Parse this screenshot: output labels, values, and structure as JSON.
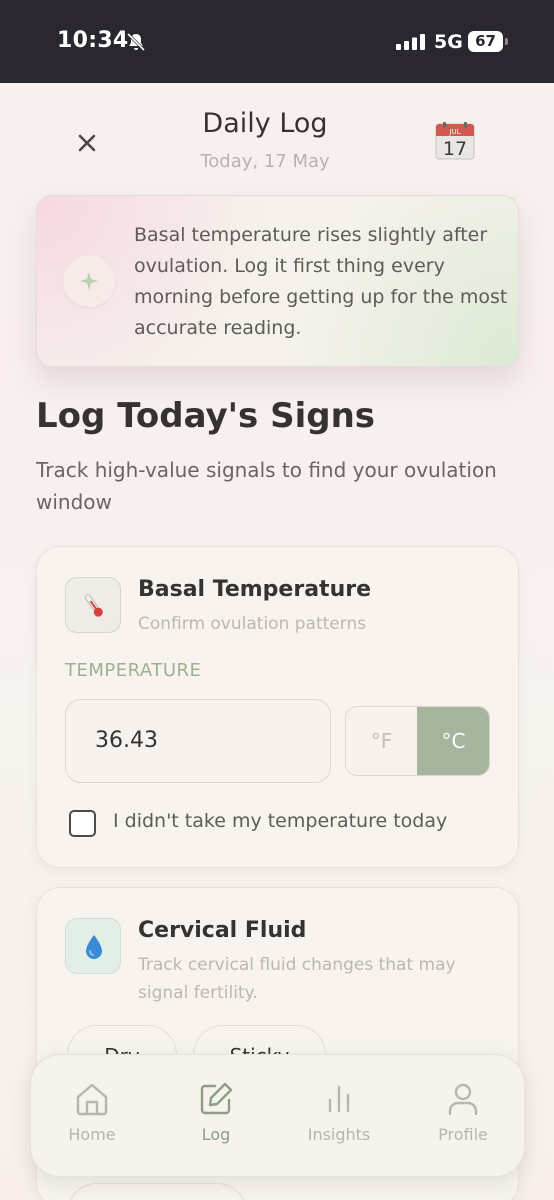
{
  "status_bar": {
    "time": "10:34",
    "network": "5G",
    "battery": "67",
    "icons": [
      "bell-slash-icon",
      "signal-icon",
      "battery-icon"
    ]
  },
  "header": {
    "title": "Daily Log",
    "subtitle": "Today, 17 May",
    "calendar_month": "JUL",
    "calendar_day": "17"
  },
  "tip": {
    "text": "Basal temperature rises slightly after ovulation. Log it first thing every morning before getting up for the most accurate reading."
  },
  "section": {
    "title": "Log Today's Signs",
    "subtitle": "Track high-value signals to find your ovulation window"
  },
  "temperature_card": {
    "title": "Basal Temperature",
    "subtitle": "Confirm ovulation patterns",
    "field_label": "TEMPERATURE",
    "value": "36.43",
    "unit_f": "°F",
    "unit_c": "°C",
    "selected_unit": "°C",
    "skip_label": "I didn't take my temperature today",
    "skip_checked": false
  },
  "fluid_card": {
    "title": "Cervical Fluid",
    "subtitle": "Track cervical fluid changes that may signal fertility.",
    "options": [
      "Dry",
      "Sticky"
    ]
  },
  "nav": {
    "items": [
      {
        "label": "Home",
        "icon": "home-icon"
      },
      {
        "label": "Log",
        "icon": "edit-icon"
      },
      {
        "label": "Insights",
        "icon": "bar-chart-icon"
      },
      {
        "label": "Profile",
        "icon": "user-icon"
      }
    ],
    "active": "Log"
  },
  "colors": {
    "accent": "#a6b59e",
    "status_bar_bg": "#2b2731",
    "background": "#f7f1ee"
  }
}
